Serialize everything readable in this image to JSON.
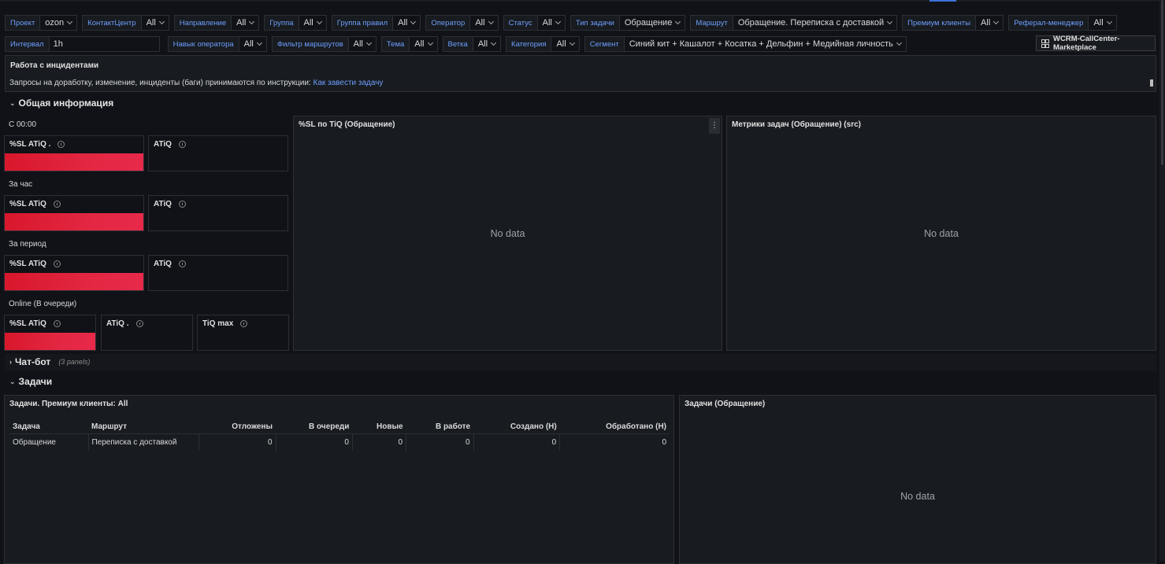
{
  "variables": {
    "row1": [
      {
        "label": "Проект",
        "value": "ozon"
      },
      {
        "label": "КонтактЦентр",
        "value": "All"
      },
      {
        "label": "Направление",
        "value": "All"
      },
      {
        "label": "Группа",
        "value": "All"
      },
      {
        "label": "Группа правил",
        "value": "All"
      },
      {
        "label": "Оператор",
        "value": "All"
      },
      {
        "label": "Статус",
        "value": "All"
      },
      {
        "label": "Тип задачи",
        "value": "Обращение"
      },
      {
        "label": "Маршрут",
        "value": "Обращение. Переписка с доставкой"
      },
      {
        "label": "Премиум клиенты",
        "value": "All"
      },
      {
        "label": "Реферал-менеджер",
        "value": "All"
      }
    ],
    "interval": {
      "label": "Интервал",
      "value": "1h"
    },
    "row2": [
      {
        "label": "Навык оператора",
        "value": "All"
      },
      {
        "label": "Фильтр маршрутов",
        "value": "All"
      },
      {
        "label": "Тема",
        "value": "All"
      },
      {
        "label": "Ветка",
        "value": "All"
      },
      {
        "label": "Категория",
        "value": "All"
      },
      {
        "label": "Сегмент",
        "value": "Синий кит + Кашалот + Косатка + Дельфин + Медийная личность"
      }
    ],
    "dashboard_link": "WCRM-CallCenter-Marketplace"
  },
  "info_panel": {
    "title": "Работа с инцидентами",
    "text": "Запросы на доработку, изменение, инциденты (баги) принимаются по инструкции:",
    "link": "Как завести задачу"
  },
  "sections": {
    "general": "Общая информация",
    "chatbot": "Чат-бот",
    "chatbot_sub": "(3 panels)",
    "tasks": "Задачи"
  },
  "stats": {
    "since": "С 00:00",
    "hour": "За час",
    "period": "За период",
    "online": "Online (В очереди)",
    "sl_atiq_dot": "%SL ATiQ .",
    "sl_atiq": "%SL ATiQ",
    "atiq": "ATiQ",
    "atiq_dot": "ATiQ .",
    "tiq_max": "TiQ max"
  },
  "panels": {
    "sl_tiq": "%SL по TiQ (Обращение)",
    "metrics": "Метрики задач (Обращение) (src)",
    "tasks_table": "Задачи. Премиум клиенты: All",
    "tasks_chart": "Задачи (Обращение)",
    "no_data": "No data"
  },
  "table": {
    "headers": [
      "Задача",
      "Маршрут",
      "Отложены",
      "В очереди",
      "Новые",
      "В работе",
      "Создано (Н)",
      "Обработано (Н)"
    ],
    "rows": [
      [
        "Обращение",
        "Переписка с доставкой",
        "0",
        "0",
        "0",
        "0",
        "0",
        "0"
      ]
    ]
  }
}
